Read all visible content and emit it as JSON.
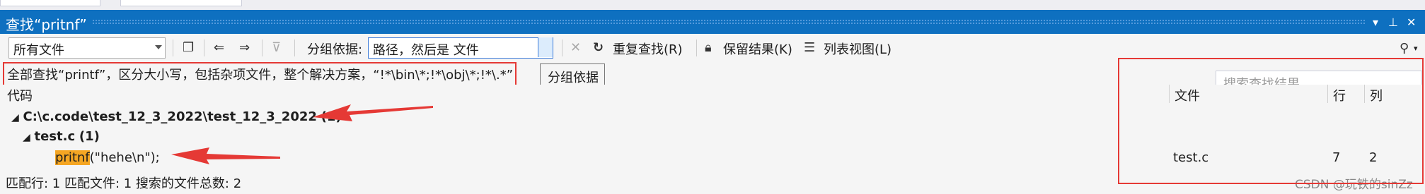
{
  "window": {
    "title": "查找“pritnf”"
  },
  "toolbar": {
    "scope_value": "所有文件",
    "group_label": "分组依据:",
    "group_value": "路径，然后是 文件",
    "repeat_find": "重复查找(R)",
    "keep_results": "保留结果(K)",
    "list_view": "列表视图(L)",
    "search_placeholder": "搜索查找结果"
  },
  "info": {
    "text": "全部查找“printf”，区分大小写，包括杂项文件，整个解决方案，“!*\\bin\\*;!*\\obj\\*;!*\\.*”"
  },
  "tooltip": {
    "text": "分组依据"
  },
  "columns": {
    "code": "代码",
    "file": "文件",
    "line": "行",
    "col": "列"
  },
  "results": {
    "path_label": "C:\\c.code\\test_12_3_2022\\test_12_3_2022",
    "path_count": "(1)",
    "file_label": "test.c",
    "file_count": "(1)",
    "match_highlight": "pritnf",
    "match_rest": "(\"hehe\\n\");",
    "match_file": "test.c",
    "match_line": "7",
    "match_col": "2"
  },
  "footer": {
    "text": "匹配行: 1 匹配文件: 1 搜索的文件总数: 2"
  },
  "watermark": {
    "text": "CSDN @玩铁的sinZz"
  },
  "colors": {
    "title_bar": "#0e70c0",
    "annotation": "#e53935",
    "highlight": "#f5a623"
  }
}
